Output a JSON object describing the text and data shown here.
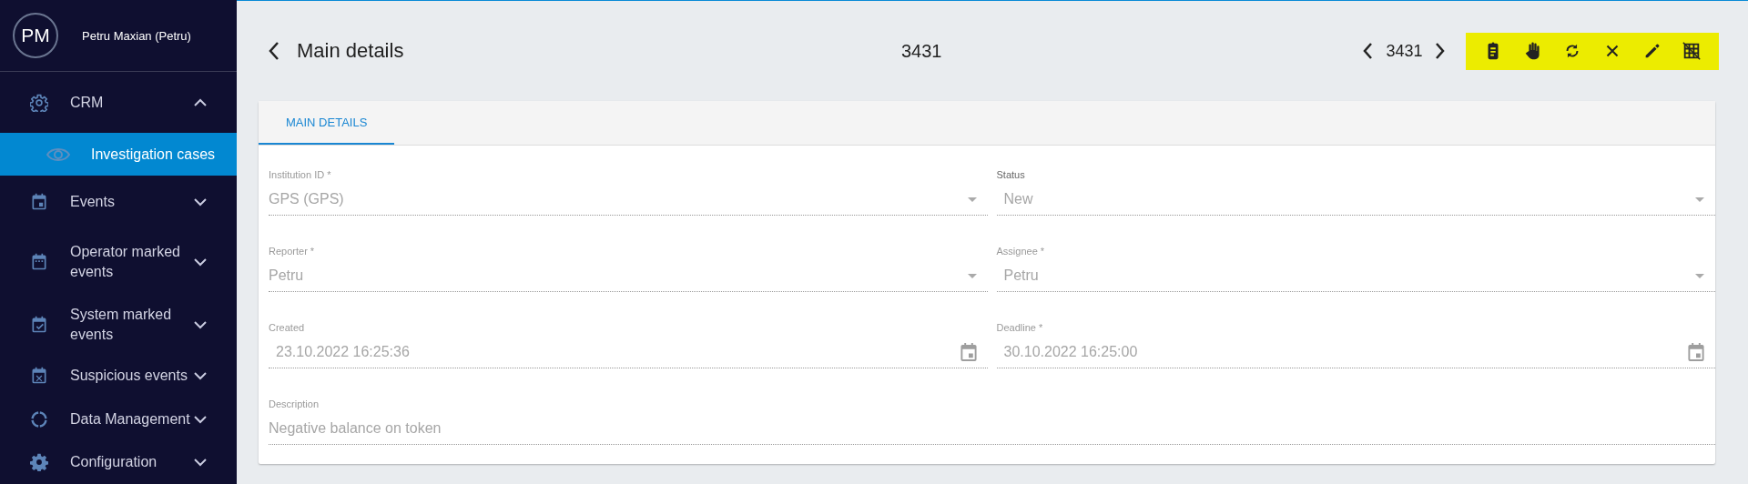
{
  "user": {
    "initials": "PM",
    "name": "Petru Maxian (Petru)"
  },
  "sidebar": {
    "items": [
      {
        "label": "CRM",
        "expanded": true,
        "children": [
          {
            "label": "Investigation cases",
            "selected": true
          }
        ]
      },
      {
        "label": "Events",
        "expanded": false
      },
      {
        "label": "Operator marked events",
        "expanded": false
      },
      {
        "label": "System marked events",
        "expanded": false
      },
      {
        "label": "Suspicious events",
        "expanded": false
      },
      {
        "label": "Data Management",
        "expanded": false
      },
      {
        "label": "Configuration",
        "expanded": false
      }
    ]
  },
  "header": {
    "title": "Main details",
    "record": "3431",
    "pager": "3431"
  },
  "tabs": [
    {
      "label": "MAIN DETAILS",
      "selected": true
    }
  ],
  "fields": [
    {
      "kind": "select",
      "label": "Institution ID *",
      "value": "GPS (GPS)"
    },
    {
      "kind": "select",
      "label": "Status",
      "value": "New"
    },
    {
      "kind": "select",
      "label": "Reporter *",
      "value": "Petru"
    },
    {
      "kind": "select",
      "label": "Assignee *",
      "value": "Petru"
    },
    {
      "kind": "date",
      "label": "Created",
      "value": "23.10.2022 16:25:36"
    },
    {
      "kind": "date",
      "label": "Deadline *",
      "value": "30.10.2022 16:25:00"
    },
    {
      "kind": "text",
      "label": "Description",
      "value": "Negative balance on token"
    }
  ]
}
